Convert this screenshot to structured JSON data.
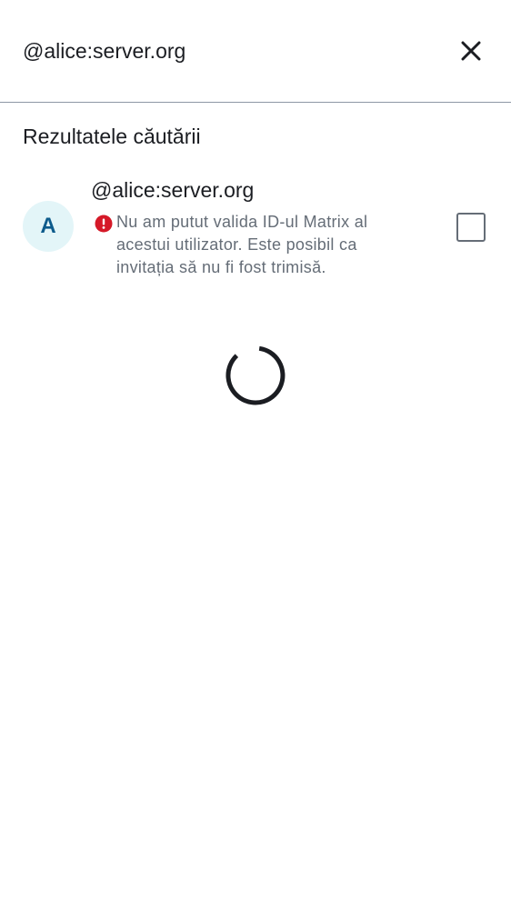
{
  "search": {
    "value": "@alice:server.org",
    "close_icon": "close-icon"
  },
  "results": {
    "title": "Rezultatele căutării",
    "items": [
      {
        "avatar_letter": "A",
        "user_id": "@alice:server.org",
        "warning": "Nu am putut valida ID-ul Matrix al acestui utilizator. Este posibil ca invitația să nu fi fost trimisă.",
        "checked": false
      }
    ]
  },
  "colors": {
    "accent": "#0d5b8c",
    "avatar_bg": "#e3f5f8",
    "error": "#d51928",
    "text_primary": "#1b1d22",
    "text_secondary": "#656d77",
    "divider": "#8d97a5"
  }
}
